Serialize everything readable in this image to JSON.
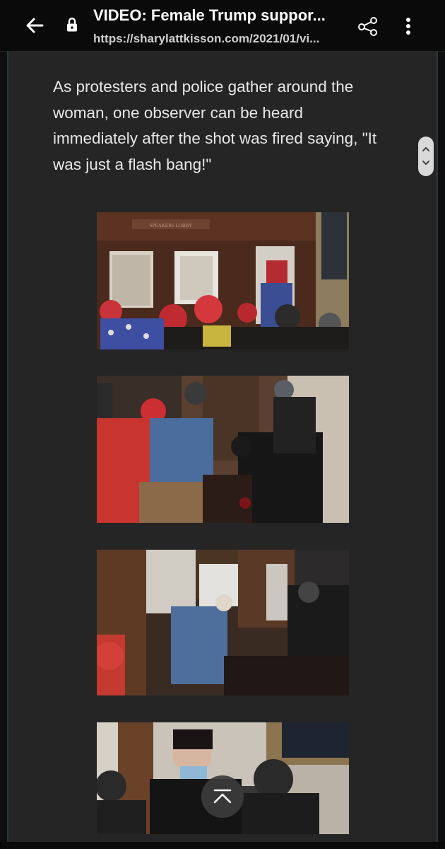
{
  "header": {
    "title": "VIDEO: Female Trump suppor...",
    "url": "https://sharylattkisson.com/2021/01/vi..."
  },
  "article": {
    "paragraph": "As protesters and police gather around the woman, one observer can be heard immediately after the shot was fired saying, \"It was just a flash bang!\""
  },
  "images": {
    "photo1_sign": "SPEAKERS LOBBY"
  },
  "colors": {
    "page_background": "#252525",
    "topbar_background": "#0a0a0a",
    "frame_border": "#263a40",
    "text": "#e8e8e8"
  },
  "icons": [
    "back-arrow-icon",
    "lock-icon",
    "share-icon",
    "more-vert-icon",
    "chevron-up-icon",
    "chevron-down-icon",
    "scroll-to-top-icon"
  ]
}
